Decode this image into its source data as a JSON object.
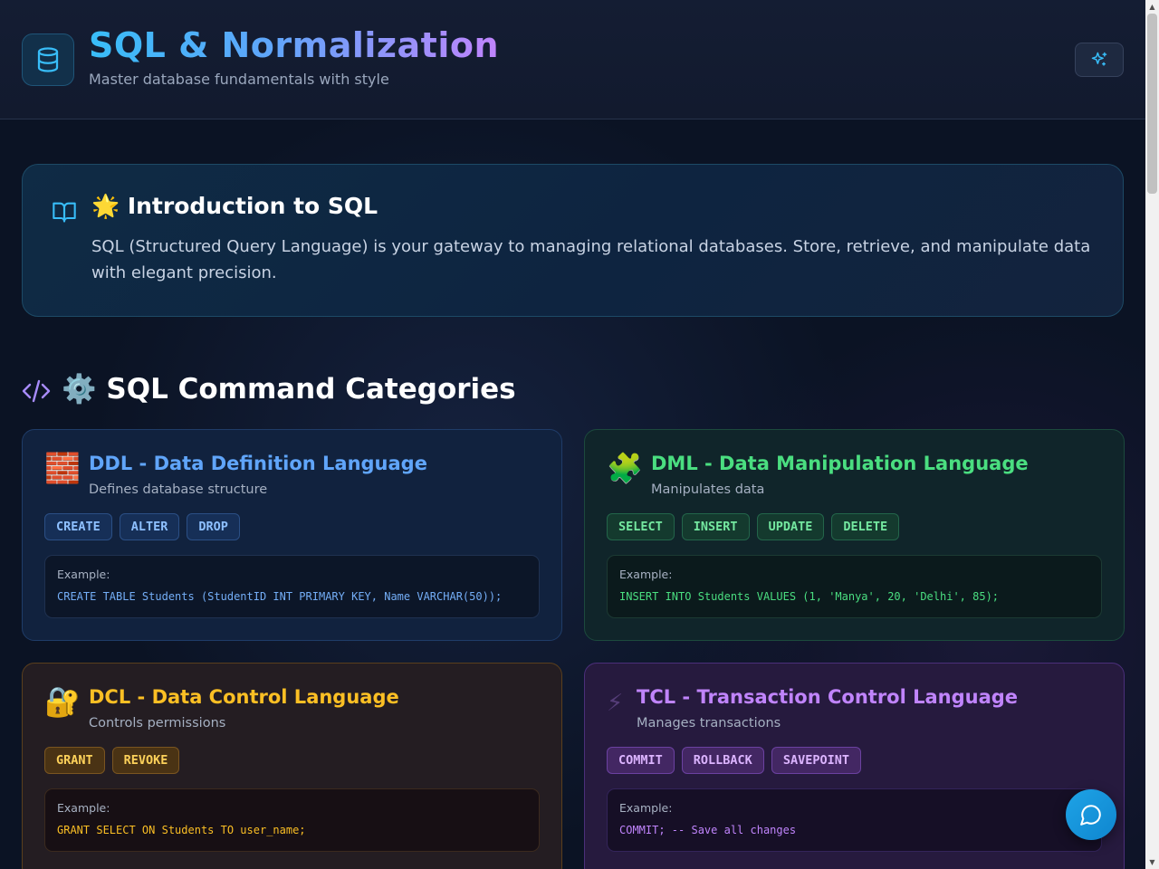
{
  "header": {
    "title": "SQL & Normalization",
    "subtitle": "Master database fundamentals with style",
    "logo_icon": "database-icon",
    "sparkle_icon": "sparkles-icon"
  },
  "intro": {
    "icon": "book-open-icon",
    "title": "🌟 Introduction to SQL",
    "text": "SQL (Structured Query Language) is your gateway to managing relational databases. Store, retrieve, and manipulate data with elegant precision."
  },
  "section": {
    "icon": "code-icon",
    "title": "⚙️ SQL Command Categories"
  },
  "categories": [
    {
      "emoji": "🧱",
      "title": "DDL - Data Definition Language",
      "description": "Defines database structure",
      "commands": [
        "CREATE",
        "ALTER",
        "DROP"
      ],
      "example_label": "Example:",
      "example_code": "CREATE TABLE Students (StudentID INT PRIMARY KEY, Name VARCHAR(50));",
      "color": "#60a5fa"
    },
    {
      "emoji": "🧩",
      "title": "DML - Data Manipulation Language",
      "description": "Manipulates data",
      "commands": [
        "SELECT",
        "INSERT",
        "UPDATE",
        "DELETE"
      ],
      "example_label": "Example:",
      "example_code": "INSERT INTO Students VALUES (1, 'Manya', 20, 'Delhi', 85);",
      "color": "#4ade80"
    },
    {
      "emoji": "🔐",
      "title": "DCL - Data Control Language",
      "description": "Controls permissions",
      "commands": [
        "GRANT",
        "REVOKE"
      ],
      "example_label": "Example:",
      "example_code": "GRANT SELECT ON Students TO user_name;",
      "color": "#fbbf24"
    },
    {
      "emoji": "⚡",
      "title": "TCL - Transaction Control Language",
      "description": "Manages transactions",
      "commands": [
        "COMMIT",
        "ROLLBACK",
        "SAVEPOINT"
      ],
      "example_label": "Example:",
      "example_code": "COMMIT; -- Save all changes",
      "color": "#c084fc"
    }
  ],
  "chat": {
    "icon": "chat-bubble-icon"
  }
}
